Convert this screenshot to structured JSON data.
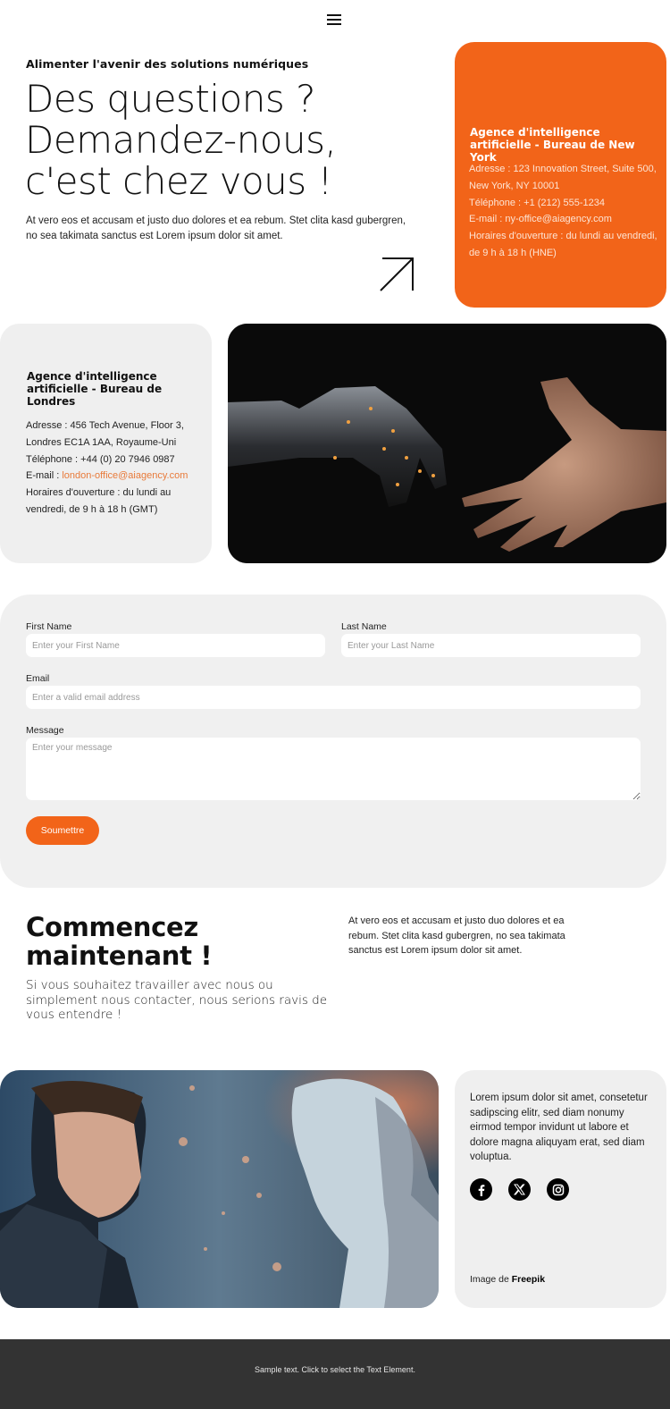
{
  "header": {
    "menu_icon": "hamburger-menu-icon"
  },
  "hero": {
    "tagline": "Alimenter l'avenir des solutions numériques",
    "title_lines": [
      "Des questions ?",
      "Demandez-nous,",
      "c'est chez vous !"
    ],
    "text": "At vero eos et accusam et justo duo dolores et ea rebum. Stet clita kasd gubergren, no sea takimata sanctus est Lorem ipsum dolor sit amet.",
    "arrow_icon": "arrow-up-right-icon"
  },
  "offices": {
    "new_york": {
      "title": "Agence d'intelligence artificielle - Bureau de New York",
      "address": "Adresse : 123 Innovation Street, Suite 500, New York, NY 10001",
      "phone": "Téléphone : +1 (212) 555-1234",
      "email": "E-mail : ny-office@aiagency.com",
      "hours": "Horaires d'ouverture : du lundi au vendredi, de 9 h à 18 h (HNE)"
    },
    "london": {
      "title": "Agence d'intelligence artificielle - Bureau de Londres",
      "address": "Adresse : 456 Tech Avenue, Floor 3, Londres EC1A 1AA, Royaume-Uni",
      "phone": "Téléphone : +44 (0) 20 7946 0987",
      "email_label": "E-mail : ",
      "email_link": "london-office@aiagency.com",
      "hours": "Horaires d'ouverture : du lundi au vendredi, de 9 h à 18 h (GMT)"
    }
  },
  "images": {
    "hands": "robot-hand-reaching-human-hand",
    "robot": "businessman-facing-humanoid-robot"
  },
  "form": {
    "first_name_label": "First Name",
    "first_name_placeholder": "Enter your First Name",
    "last_name_label": "Last Name",
    "last_name_placeholder": "Enter your Last Name",
    "email_label": "Email",
    "email_placeholder": "Enter a valid email address",
    "message_label": "Message",
    "message_placeholder": "Enter your message",
    "submit_label": "Soumettre"
  },
  "cta": {
    "title_lines": [
      "Commencez",
      "maintenant !"
    ],
    "subtitle": "Si vous souhaitez travailler avec nous ou simplement nous contacter, nous serions ravis de vous entendre !",
    "text": "At vero eos et accusam et justo duo dolores et ea rebum. Stet clita kasd gubergren, no sea takimata sanctus est Lorem ipsum dolor sit amet."
  },
  "social": {
    "text": "Lorem ipsum dolor sit amet, consetetur sadipscing elitr, sed diam nonumy eirmod tempor invidunt ut labore et dolore magna aliquyam erat, sed diam voluptua.",
    "icons": [
      "facebook-icon",
      "x-twitter-icon",
      "instagram-icon"
    ],
    "credit_prefix": "Image de ",
    "credit_brand": "Freepik"
  },
  "footer": {
    "text": "Sample text. Click to select the Text Element."
  },
  "colors": {
    "accent": "#f26419",
    "card_bg": "#efefef",
    "footer_bg": "#333333",
    "link": "#e87a3a"
  }
}
